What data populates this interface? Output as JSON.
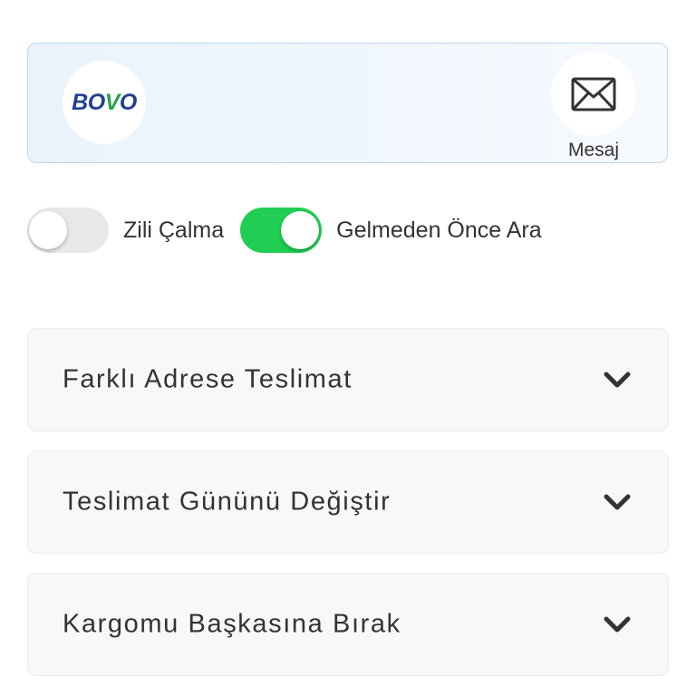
{
  "courier": {
    "logo_prefix": "BO",
    "logo_accent": "V",
    "logo_suffix": "O",
    "message_label": "Mesaj",
    "message_icon": "envelope-icon"
  },
  "toggles": [
    {
      "label": "Zili Çalma",
      "on": false
    },
    {
      "label": "Gelmeden Önce Ara",
      "on": true
    }
  ],
  "accordions": [
    {
      "title": "Farklı Adrese Teslimat",
      "icon": "chevron-down-icon"
    },
    {
      "title": "Teslimat Gününü Değiştir",
      "icon": "chevron-down-icon"
    },
    {
      "title": "Kargomu Başkasına Bırak",
      "icon": "chevron-down-icon"
    }
  ],
  "colors": {
    "toggle_on": "#1fce52",
    "toggle_off": "#e8e8e8",
    "card_border": "#bcd9f0",
    "logo_blue": "#22408f",
    "logo_green": "#2aa04a"
  }
}
